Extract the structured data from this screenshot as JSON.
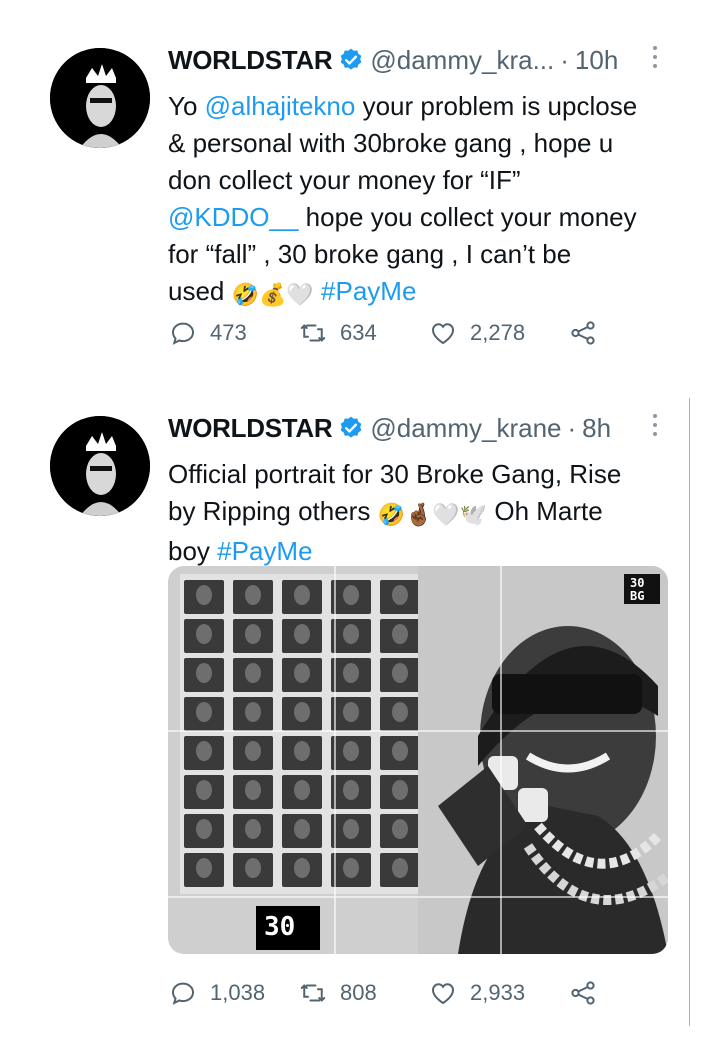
{
  "tweets": [
    {
      "author_name": "WORLDSTAR",
      "handle": "@dammy_kra...",
      "dot": "·",
      "time": "10h",
      "text_lines": [
        [
          "Yo ",
          "@alhajitekno",
          " your problem is upclose"
        ],
        [
          "& personal with 30broke gang  , hope u"
        ],
        [
          "don collect your money for “IF”"
        ],
        [
          "@KDDO__",
          " hope you collect your money"
        ],
        [
          "for “fall” , 30 broke gang , I can’t be"
        ],
        [
          "used ",
          "🤣💰🤍",
          " ",
          "#PayMe"
        ]
      ],
      "replies": "473",
      "retweets": "634",
      "likes": "2,278"
    },
    {
      "author_name": "WORLDSTAR",
      "handle": "@dammy_krane",
      "dot": "·",
      "time": "8h",
      "text_line1": "Official portrait for 30 Broke Gang, Rise",
      "text_line2_a": "by Ripping others ",
      "text_line2_emoji": "🤣🤞🏾🤍🕊️",
      "text_line2_b": " Oh Marte",
      "text_line3_a": "boy ",
      "text_line3_tag": "#PayMe",
      "media_logo": [
        "30",
        "BG"
      ],
      "media_footer": "30",
      "replies": "1,038",
      "retweets": "808",
      "likes": "2,933"
    }
  ],
  "colors": {
    "link": "#1d9bf0",
    "verified": "#1d9bf0",
    "muted": "#536471",
    "text": "#0f1419"
  },
  "icons": [
    "verified-badge-icon",
    "more-icon",
    "reply-icon",
    "retweet-icon",
    "like-icon",
    "share-icon"
  ]
}
